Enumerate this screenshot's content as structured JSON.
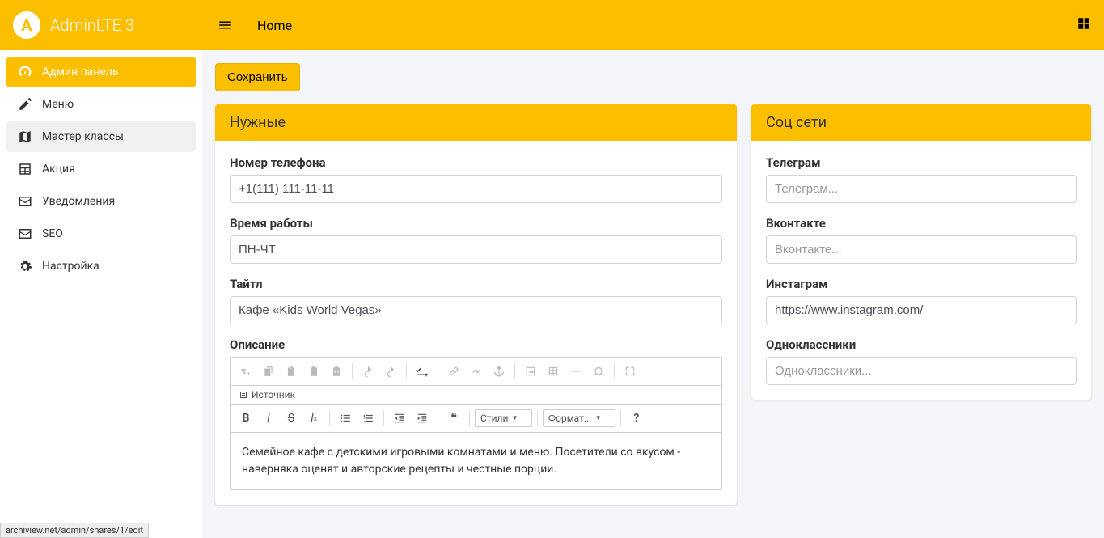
{
  "brand": "AdminLTE 3",
  "topbar": {
    "home": "Home"
  },
  "sidebar": {
    "items": [
      {
        "label": "Админ панель",
        "icon": "dashboard",
        "active": true
      },
      {
        "label": "Меню",
        "icon": "edit",
        "active": false
      },
      {
        "label": "Мастер классы",
        "icon": "map",
        "active": false
      },
      {
        "label": "Акция",
        "icon": "table",
        "active": false
      },
      {
        "label": "Уведомления",
        "icon": "envelope",
        "active": false
      },
      {
        "label": "SEO",
        "icon": "envelope",
        "active": false
      },
      {
        "label": "Настройка",
        "icon": "cog",
        "active": false
      }
    ]
  },
  "buttons": {
    "save": "Сохранить"
  },
  "cards": {
    "needed": {
      "title": "Нужные",
      "phone_label": "Номер телефона",
      "phone_value": "+1(111) 111-11-11",
      "hours_label": "Время работы",
      "hours_value": "ПН-ЧТ",
      "title_label": "Тайтл",
      "title_value": "Кафе «Kids World Vegas»",
      "desc_label": "Описание",
      "desc_value": "Семейное кафе с детскими игровыми комнатами и меню. Посетители со вкусом - наверняка оценят и авторские рецепты и честные порции."
    },
    "social": {
      "title": "Соц сети",
      "telegram_label": "Телеграм",
      "telegram_placeholder": "Телеграм...",
      "vk_label": "Вконтакте",
      "vk_placeholder": "Вконтакте...",
      "ig_label": "Инстаграм",
      "ig_value": "https://www.instagram.com/",
      "ok_label": "Одноклассники",
      "ok_placeholder": "Одноклассники..."
    }
  },
  "editor": {
    "source": "Источник",
    "styles": "Стили",
    "format": "Формат..."
  },
  "statusbar": "archiview.net/admin/shares/1/edit"
}
